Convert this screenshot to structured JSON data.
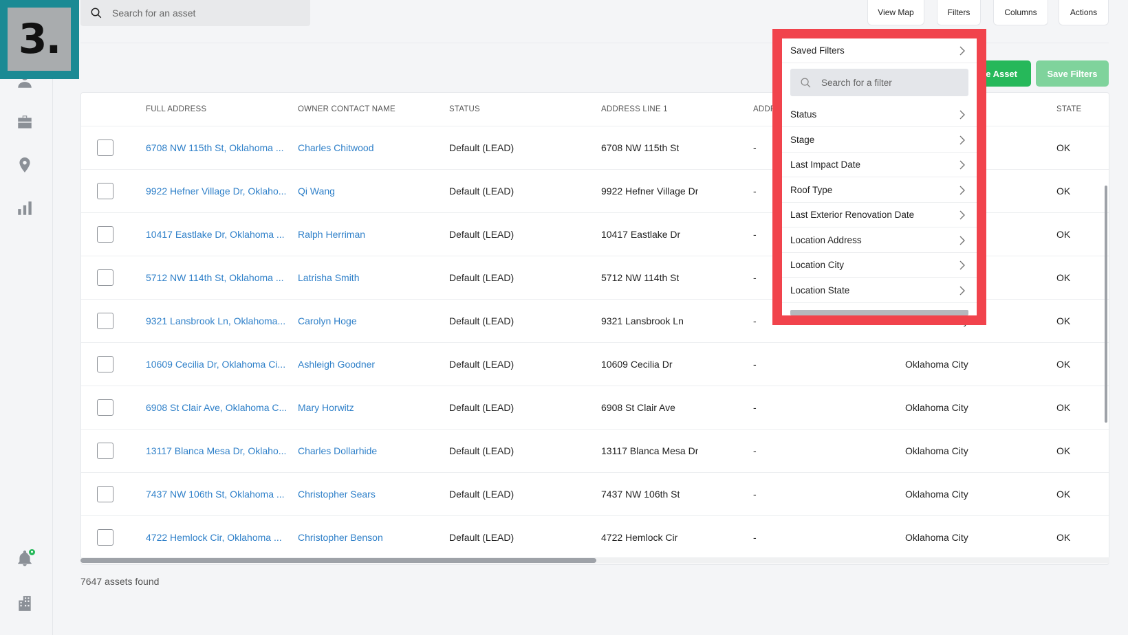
{
  "step_badge": "3.",
  "search": {
    "placeholder": "Search for an asset"
  },
  "toolbar": {
    "view_map": "View Map",
    "filters": "Filters",
    "columns": "Columns",
    "actions": "Actions",
    "create_asset_partial": "e Asset",
    "save_filters": "Save Filters"
  },
  "colors": {
    "accent_green": "#26b85a",
    "save_filters_green": "#7fd39c",
    "link_blue": "#2f80c9",
    "highlight_red": "#f1434c"
  },
  "sidebar": {
    "icons": [
      "user-icon",
      "briefcase-icon",
      "location-pin-icon",
      "bar-chart-icon",
      "bell-icon",
      "building-icon"
    ]
  },
  "table": {
    "headers": {
      "full_address": "FULL ADDRESS",
      "owner_contact_name": "OWNER CONTACT NAME",
      "status": "STATUS",
      "address_line_1": "ADDRESS LINE 1",
      "address_line_2": "ADDRE",
      "state": "STATE"
    },
    "rows": [
      {
        "full_address": "6708 NW 115th St, Oklahoma ...",
        "owner": "Charles Chitwood",
        "status": "Default (LEAD)",
        "address1": "6708 NW 115th St",
        "address2": "-",
        "city": "",
        "state": "OK"
      },
      {
        "full_address": "9922 Hefner Village Dr, Oklaho...",
        "owner": "Qi Wang",
        "status": "Default (LEAD)",
        "address1": "9922 Hefner Village Dr",
        "address2": "-",
        "city": "",
        "state": "OK"
      },
      {
        "full_address": "10417 Eastlake Dr, Oklahoma ...",
        "owner": "Ralph Herriman",
        "status": "Default (LEAD)",
        "address1": "10417 Eastlake Dr",
        "address2": "-",
        "city": "",
        "state": "OK"
      },
      {
        "full_address": "5712 NW 114th St, Oklahoma ...",
        "owner": "Latrisha Smith",
        "status": "Default (LEAD)",
        "address1": "5712 NW 114th St",
        "address2": "-",
        "city": "",
        "state": "OK"
      },
      {
        "full_address": "9321 Lansbrook Ln, Oklahoma...",
        "owner": "Carolyn Hoge",
        "status": "Default (LEAD)",
        "address1": "9321 Lansbrook Ln",
        "address2": "-",
        "city": "Oklahoma City",
        "state": "OK"
      },
      {
        "full_address": "10609 Cecilia Dr, Oklahoma Ci...",
        "owner": "Ashleigh Goodner",
        "status": "Default (LEAD)",
        "address1": "10609 Cecilia Dr",
        "address2": "-",
        "city": "Oklahoma City",
        "state": "OK"
      },
      {
        "full_address": "6908 St Clair Ave, Oklahoma C...",
        "owner": "Mary Horwitz",
        "status": "Default (LEAD)",
        "address1": "6908 St Clair Ave",
        "address2": "-",
        "city": "Oklahoma City",
        "state": "OK"
      },
      {
        "full_address": "13117 Blanca Mesa Dr, Oklaho...",
        "owner": "Charles Dollarhide",
        "status": "Default (LEAD)",
        "address1": "13117 Blanca Mesa Dr",
        "address2": "-",
        "city": "Oklahoma City",
        "state": "OK"
      },
      {
        "full_address": "7437 NW 106th St, Oklahoma ...",
        "owner": "Christopher Sears",
        "status": "Default (LEAD)",
        "address1": "7437 NW 106th St",
        "address2": "-",
        "city": "Oklahoma City",
        "state": "OK"
      },
      {
        "full_address": "4722 Hemlock Cir, Oklahoma ...",
        "owner": "Christopher Benson",
        "status": "Default (LEAD)",
        "address1": "4722 Hemlock Cir",
        "address2": "-",
        "city": "Oklahoma City",
        "state": "OK"
      }
    ]
  },
  "footer": {
    "assets_found": "7647 assets found"
  },
  "filter_menu": {
    "saved_filters": "Saved Filters",
    "search_placeholder": "Search for a filter",
    "items": [
      "Status",
      "Stage",
      "Last Impact Date",
      "Roof Type",
      "Last Exterior Renovation Date",
      "Location Address",
      "Location City",
      "Location State"
    ]
  }
}
